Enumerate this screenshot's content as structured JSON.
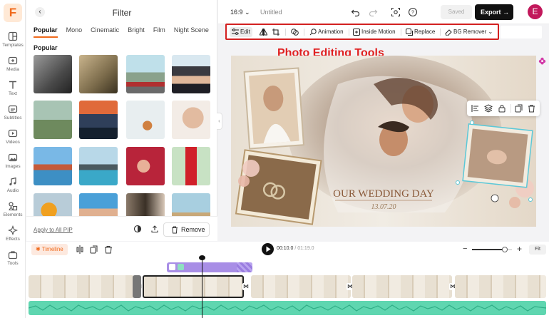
{
  "rail": {
    "items": [
      {
        "label": "Templates",
        "icon": "templates-icon"
      },
      {
        "label": "Media",
        "icon": "media-icon"
      },
      {
        "label": "Text",
        "icon": "text-icon"
      },
      {
        "label": "Subtitles",
        "icon": "subtitles-icon"
      },
      {
        "label": "Videos",
        "icon": "videos-icon"
      },
      {
        "label": "Images",
        "icon": "images-icon"
      },
      {
        "label": "Audio",
        "icon": "audio-icon"
      },
      {
        "label": "Elements",
        "icon": "elements-icon"
      },
      {
        "label": "Effects",
        "icon": "effects-icon"
      },
      {
        "label": "Tools",
        "icon": "tools-icon"
      }
    ]
  },
  "panel": {
    "title": "Filter",
    "tabs": [
      "Popular",
      "Mono",
      "Cinematic",
      "Bright",
      "Film",
      "Night Scene",
      "Pa"
    ],
    "active_tab": "Popular",
    "section": "Popular",
    "apply_all": "Apply to All PIP",
    "remove": "Remove"
  },
  "topbar": {
    "ratio": "16:9",
    "title": "Untitled",
    "saved": "Saved",
    "export": "Export",
    "avatar": "E"
  },
  "edit_toolbar": {
    "edit": "Edit",
    "animation": "Animation",
    "inside_motion": "Inside Motion",
    "replace": "Replace",
    "bg_remover": "BG Remover"
  },
  "annotation": "Photo Editing Tools",
  "canvas": {
    "title_text": "OUR WEDDING DAY",
    "date_text": "13.07.20"
  },
  "timeline": {
    "label": "Timeline",
    "current": "00:10.0",
    "total": "/ 01:19.0",
    "fit": "Fit",
    "zoom": 0.82
  },
  "colors": {
    "accent": "#f06a1c",
    "highlight_box": "#d32020",
    "audio": "#5fd6b0",
    "clip_purple": "#a88ee6"
  }
}
